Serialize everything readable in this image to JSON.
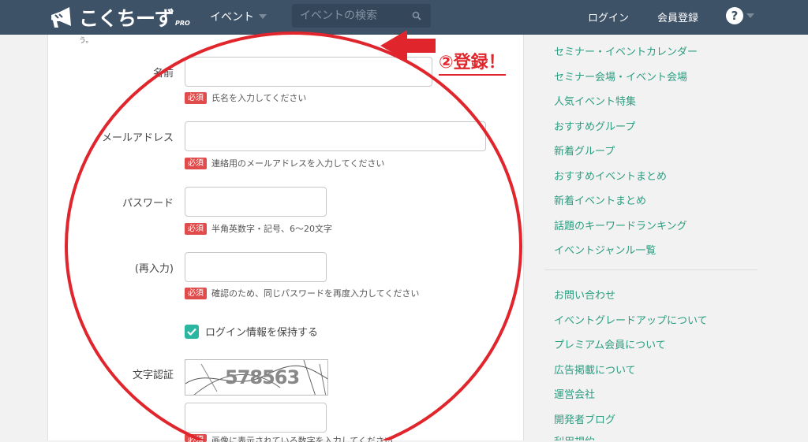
{
  "header": {
    "logo_text": "こくちーず",
    "logo_pro": "PRO",
    "event_menu": "イベント",
    "search_placeholder": "イベントの検索",
    "login": "ログイン",
    "register": "会員登録",
    "help": "?"
  },
  "form": {
    "top_fragment": "う。",
    "name": {
      "label": "名前",
      "required": "必須",
      "hint": "氏名を入力してください"
    },
    "email": {
      "label": "メールアドレス",
      "required": "必須",
      "hint": "連絡用のメールアドレスを入力してください"
    },
    "password": {
      "label": "パスワード",
      "required": "必須",
      "hint": "半角英数字・記号、6〜20文字"
    },
    "password_confirm": {
      "label": "(再入力)",
      "required": "必須",
      "hint": "確認のため、同じパスワードを再度入力してください"
    },
    "remember": {
      "label": "ログイン情報を保持する",
      "checked": true
    },
    "captcha": {
      "label": "文字認証",
      "image_text": "578563"
    },
    "bottom_fragment": {
      "required": "必須",
      "hint": "画像に表示されている数字を入力してください"
    }
  },
  "sidebar": {
    "group1": [
      "セミナー・イベントカレンダー",
      "セミナー会場・イベント会場",
      "人気イベント特集",
      "おすすめグループ",
      "新着グループ",
      "おすすめイベントまとめ",
      "新着イベントまとめ",
      "話題のキーワードランキング",
      "イベントジャンル一覧"
    ],
    "group2": [
      "お問い合わせ",
      "イベントグレードアップについて",
      "プレミアム会員について",
      "広告掲載について",
      "運営会社",
      "開発者ブログ",
      "利用規約"
    ]
  },
  "annotation": {
    "text": "②登録！",
    "color": "#e0262c"
  },
  "colors": {
    "header_bg": "#3d5167",
    "link": "#2a9d7f",
    "required_badge": "#e04b4b",
    "checkbox": "#2bb6a2"
  }
}
